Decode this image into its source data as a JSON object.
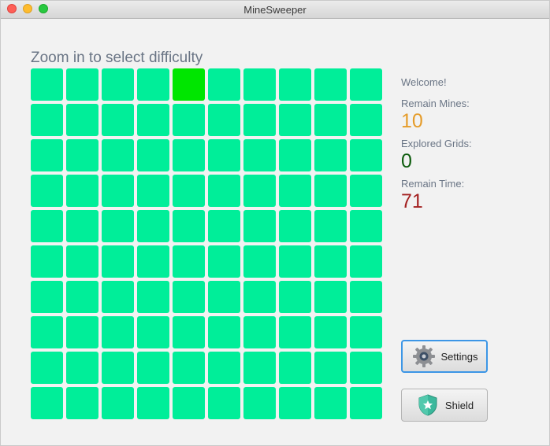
{
  "window": {
    "title": "MineSweeper"
  },
  "heading": "Zoom in to select difficulty",
  "grid": {
    "rows": 10,
    "cols": 10,
    "highlighted_cell": {
      "row": 1,
      "col": 5
    }
  },
  "colors": {
    "cell": "#00ee99",
    "cell_hover": "#00e600",
    "mines": "#e59c2a",
    "explored": "#0d5c0d",
    "time": "#a32020"
  },
  "status": {
    "welcome": "Welcome!",
    "remain_mines_label": "Remain Mines:",
    "remain_mines_value": "10",
    "explored_label": "Explored Grids:",
    "explored_value": "0",
    "remain_time_label": "Remain Time:",
    "remain_time_value": "71"
  },
  "buttons": {
    "settings_label": "Settings",
    "settings_icon": "gear-icon",
    "shield_label": "Shield",
    "shield_icon": "shield-star-icon"
  }
}
